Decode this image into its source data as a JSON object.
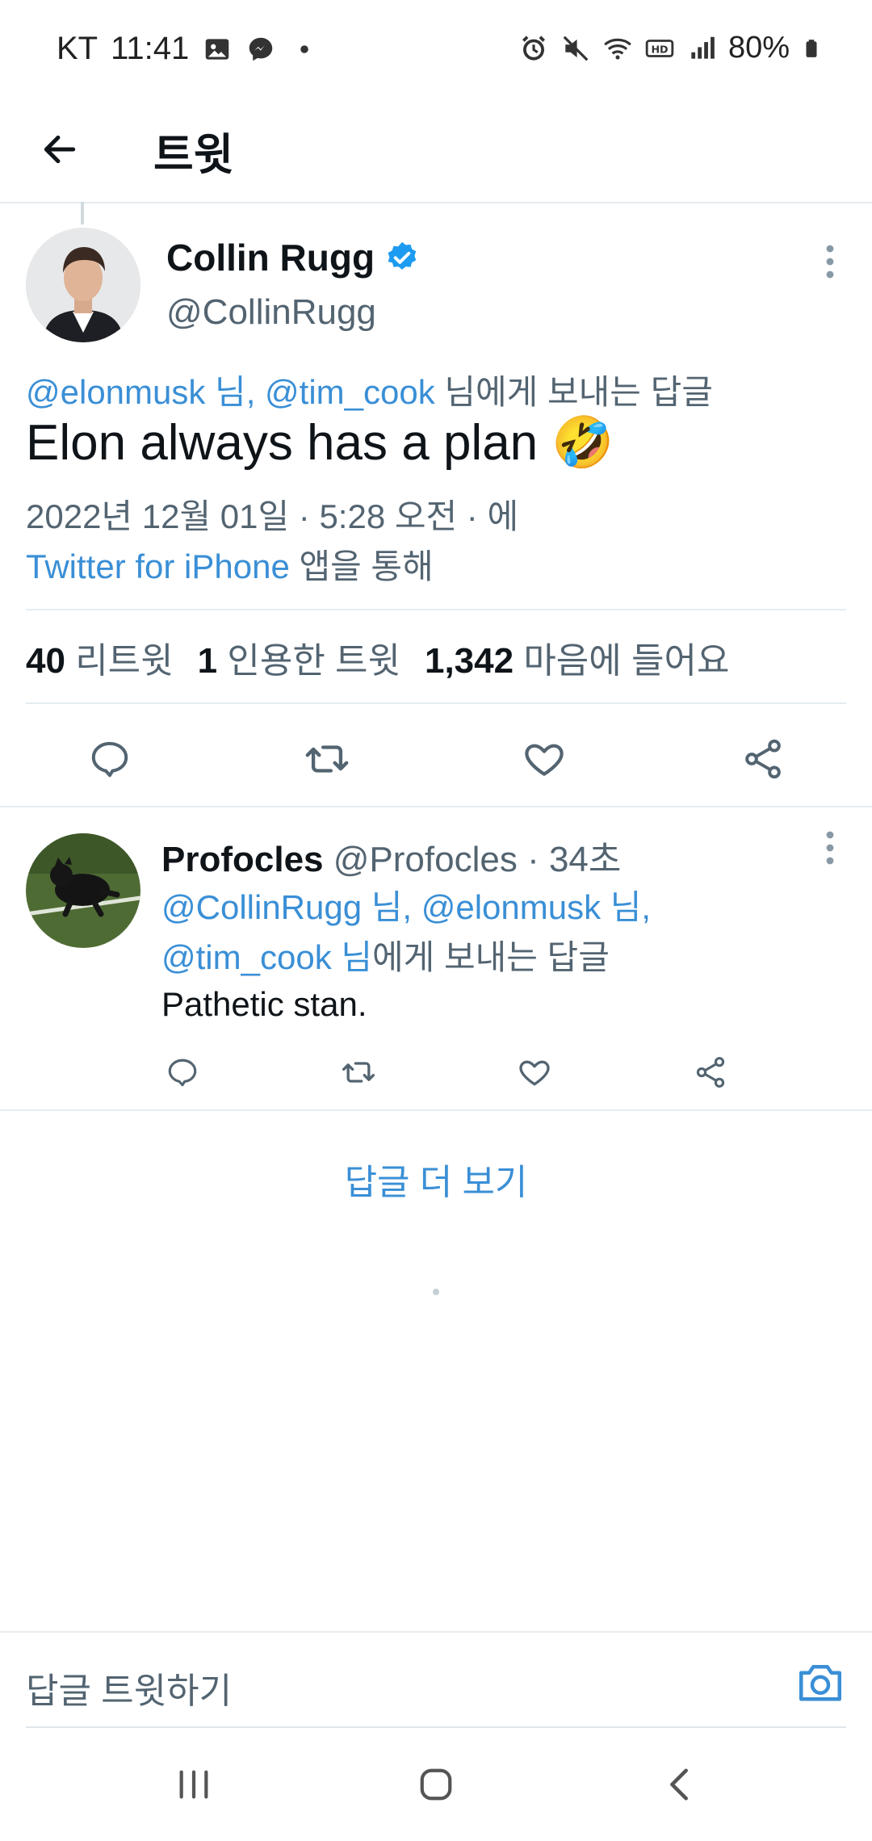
{
  "status_bar": {
    "carrier": "KT",
    "time": "11:41",
    "battery": "80%",
    "icons": [
      "image-icon",
      "messenger-icon",
      "dot-icon",
      "alarm-icon",
      "mute-icon",
      "wifi-icon",
      "hd-icon",
      "signal-icon",
      "battery-icon"
    ]
  },
  "header": {
    "title": "트윗"
  },
  "tweet": {
    "display_name": "Collin Rugg",
    "handle": "@CollinRugg",
    "reply_to_prefix": "@elonmusk 님, @tim_cook",
    "reply_to_suffix": " 님에게 보내는 답글",
    "text": "Elon always has a plan 🤣",
    "timestamp": "2022년 12월 01일 · 5:28 오전 · 에",
    "source_link": "Twitter for iPhone",
    "source_suffix": " 앱을 통해",
    "stats": {
      "retweets_count": "40",
      "retweets_label": "리트윗",
      "quotes_count": "1",
      "quotes_label": "인용한 트윗",
      "likes_count": "1,342",
      "likes_label": "마음에 들어요"
    }
  },
  "reply": {
    "display_name": "Profocles",
    "handle": "@Profocles",
    "time": "· 34초",
    "reply_to_line1": "@CollinRugg 님, @elonmusk 님,",
    "reply_to_line2_link": "@tim_cook 님",
    "reply_to_line2_suffix": "에게 보내는 답글",
    "text": "Pathetic stan."
  },
  "more_replies": "답글 더 보기",
  "compose": {
    "placeholder": "답글 트윗하기"
  },
  "colors": {
    "link": "#3a8fd6",
    "text": "#0f1419",
    "secondary": "#536471",
    "verified": "#1d9bf0"
  }
}
